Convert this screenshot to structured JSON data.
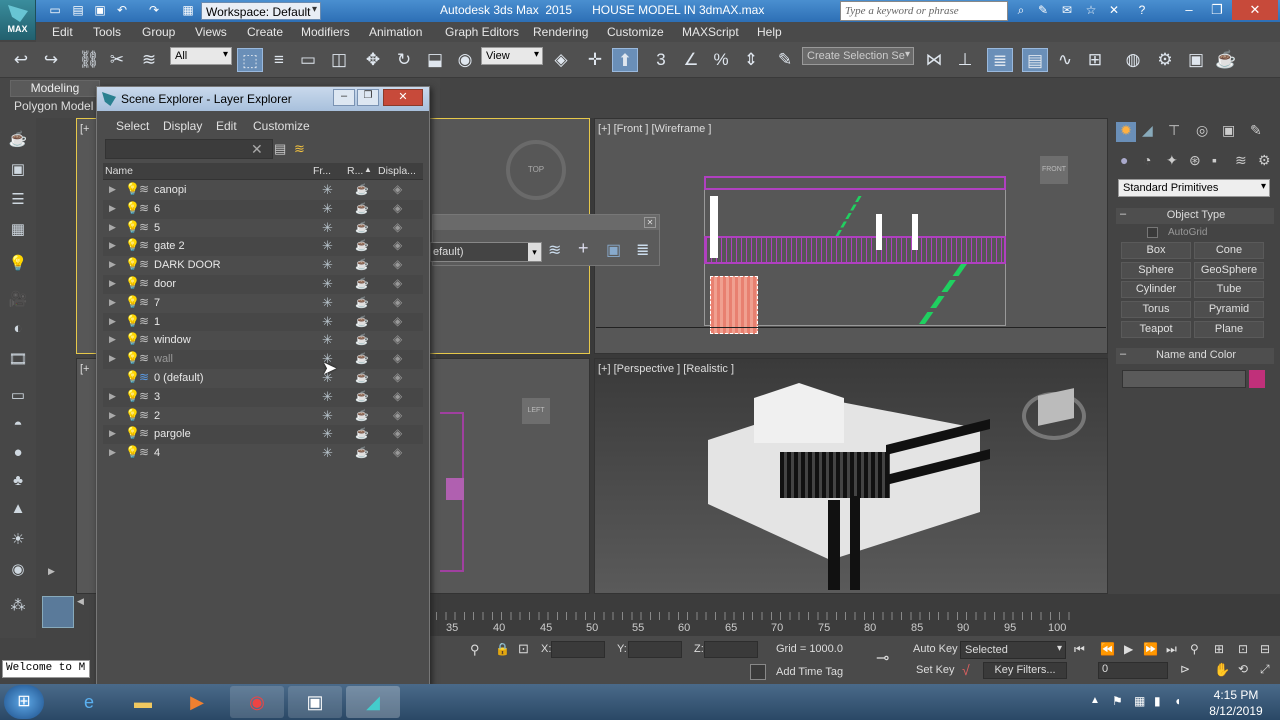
{
  "app": {
    "logo_label": "MAX",
    "workspace": "Workspace: Default",
    "title": "Autodesk 3ds Max  2015      HOUSE MODEL IN 3dmAX.max",
    "search_placeholder": "Type a keyword or phrase"
  },
  "menu": [
    "Edit",
    "Tools",
    "Group",
    "Views",
    "Create",
    "Modifiers",
    "Animation",
    "Graph Editors",
    "Rendering",
    "Customize",
    "MAXScript",
    "Help"
  ],
  "toolbar": {
    "selection_filter": "All",
    "ref_coord": "View",
    "named_selection": "Create Selection Se"
  },
  "ribbon": {
    "tab": "Modeling",
    "subtab": "Polygon Model"
  },
  "viewports": {
    "front_label": "[+] [Front ] [Wireframe ]",
    "perspective_label": "[+] [Perspective ] [Realistic ]",
    "top_label": "[+",
    "left_label": "[+",
    "top_cube": "TOP",
    "front_cube": "FRONT",
    "left_cube": "LEFT"
  },
  "command_panel": {
    "category": "Standard Primitives",
    "object_type_title": "Object Type",
    "autogrid": "AutoGrid",
    "buttons": [
      "Box",
      "Cone",
      "Sphere",
      "GeoSphere",
      "Cylinder",
      "Tube",
      "Torus",
      "Pyramid",
      "Teapot",
      "Plane"
    ],
    "name_color_title": "Name and Color",
    "color": "#c0307a"
  },
  "scene_explorer": {
    "title": "Scene Explorer - Layer Explorer",
    "menu": [
      "Select",
      "Display",
      "Edit",
      "Customize"
    ],
    "columns": [
      "Name",
      "Fr...",
      "R...",
      "Displa..."
    ],
    "layers": [
      {
        "name": "canopi",
        "hidden": false
      },
      {
        "name": "6",
        "hidden": false
      },
      {
        "name": "5",
        "hidden": false
      },
      {
        "name": "gate 2",
        "hidden": false
      },
      {
        "name": "DARK DOOR",
        "hidden": false
      },
      {
        "name": "door",
        "hidden": false
      },
      {
        "name": "7",
        "hidden": false
      },
      {
        "name": "1",
        "hidden": false
      },
      {
        "name": "window",
        "hidden": false
      },
      {
        "name": "wall",
        "hidden": true
      },
      {
        "name": "0 (default)",
        "hidden": false
      },
      {
        "name": "3",
        "hidden": false
      },
      {
        "name": "2",
        "hidden": false
      },
      {
        "name": "pargole",
        "hidden": false
      },
      {
        "name": "4",
        "hidden": false
      }
    ]
  },
  "floating_toolbar": {
    "layer": "efault)"
  },
  "timeline": {
    "ticks": [
      "35",
      "40",
      "45",
      "50",
      "55",
      "60",
      "65",
      "70",
      "75",
      "80",
      "85",
      "90",
      "95",
      "100"
    ]
  },
  "status": {
    "x_label": "X:",
    "y_label": "Y:",
    "z_label": "Z:",
    "grid": "Grid = 1000.0",
    "add_time_tag": "Add Time Tag",
    "auto_key": "Auto Key",
    "set_key": "Set Key",
    "key_mode": "Selected",
    "key_filters": "Key Filters...",
    "frame": "0"
  },
  "maxscript_listener": "Welcome to M",
  "taskbar": {
    "time": "4:15 PM",
    "date": "8/12/2019"
  }
}
